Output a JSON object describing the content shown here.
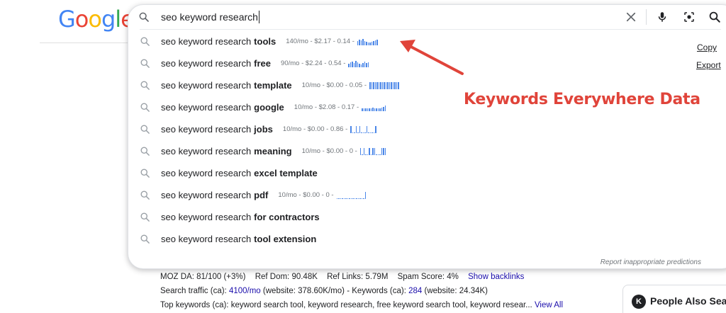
{
  "logo": {
    "letters": [
      "G",
      "o",
      "o",
      "g",
      "l",
      "e"
    ],
    "colors": [
      "#4285F4",
      "#EA4335",
      "#FBBC05",
      "#4285F4",
      "#34A853",
      "#EA4335"
    ]
  },
  "search": {
    "value": "seo keyword research"
  },
  "suggestions": [
    {
      "prefix": "seo keyword research",
      "suffix": "tools",
      "meta": "140/mo - $2.17 - 0.14 -",
      "trend": [
        6,
        8,
        7,
        9,
        6,
        5,
        4,
        4,
        5,
        6,
        7,
        8
      ]
    },
    {
      "prefix": "seo keyword research",
      "suffix": "free",
      "meta": "90/mo - $2.24 - 0.54 -",
      "trend": [
        5,
        7,
        8,
        6,
        9,
        7,
        5,
        4,
        6,
        8,
        6,
        7
      ]
    },
    {
      "prefix": "seo keyword research",
      "suffix": "template",
      "meta": "10/mo - $0.00 - 0.05 -",
      "trend": [
        10,
        10,
        10,
        10,
        10,
        10,
        10,
        10,
        10,
        10,
        10,
        10,
        10,
        10,
        10,
        10,
        10
      ]
    },
    {
      "prefix": "seo keyword research",
      "suffix": "google",
      "meta": "10/mo - $2.08 - 0.17 -",
      "trend": [
        4,
        4,
        4,
        4,
        4,
        4,
        5,
        4,
        4,
        4,
        4,
        5,
        6,
        8
      ]
    },
    {
      "prefix": "seo keyword research",
      "suffix": "jobs",
      "meta": "10/mo - $0.00 - 0.86 -",
      "trend": [
        10,
        1,
        1,
        10,
        1,
        10,
        1,
        1,
        1,
        10,
        1,
        1,
        1,
        1,
        10
      ]
    },
    {
      "prefix": "seo keyword research",
      "suffix": "meaning",
      "meta": "10/mo - $0.00 - 0 -",
      "trend": [
        10,
        1,
        10,
        1,
        1,
        10,
        1,
        10,
        10,
        1,
        1,
        1,
        10,
        10,
        10
      ]
    },
    {
      "prefix": "seo keyword research",
      "suffix": "excel template",
      "meta": "",
      "trend": []
    },
    {
      "prefix": "seo keyword research",
      "suffix": "pdf",
      "meta": "10/mo - $0.00 - 0 -",
      "trend": [
        1,
        1,
        1,
        1,
        1,
        1,
        1,
        1,
        1,
        1,
        1,
        1,
        1,
        1,
        1,
        1,
        10
      ]
    },
    {
      "prefix": "seo keyword research",
      "suffix": "for contractors",
      "meta": "",
      "trend": []
    },
    {
      "prefix": "seo keyword research",
      "suffix": "tool extension",
      "meta": "",
      "trend": []
    }
  ],
  "report_link": "Report inappropriate predictions",
  "annotation": "Keywords Everywhere Data",
  "side_links": {
    "copy": "Copy",
    "export": "Export"
  },
  "ke_bar": {
    "moz_da": "MOZ DA: 81/100 (+3%)",
    "ref_dom": "Ref Dom: 90.48K",
    "ref_links": "Ref Links: 5.79M",
    "spam": "Spam Score: 4%",
    "show_backlinks": "Show backlinks",
    "traffic_label": "Search traffic (ca):",
    "traffic_value": "4100/mo",
    "traffic_website": "(website: 378.60K/mo)",
    "keywords_label": "- Keywords (ca):",
    "keywords_value": "284",
    "keywords_website": "(website: 24.34K)",
    "top_keywords": "Top keywords (ca): keyword search tool, keyword research, free keyword search tool, keyword resear...",
    "view_all": "View All"
  },
  "paa": {
    "logo": "K",
    "title": "People Also Sea"
  },
  "colors": {
    "accent_red": "#e0443a",
    "link_blue": "#1a0dab",
    "trend_blue": "#4a86e8"
  }
}
